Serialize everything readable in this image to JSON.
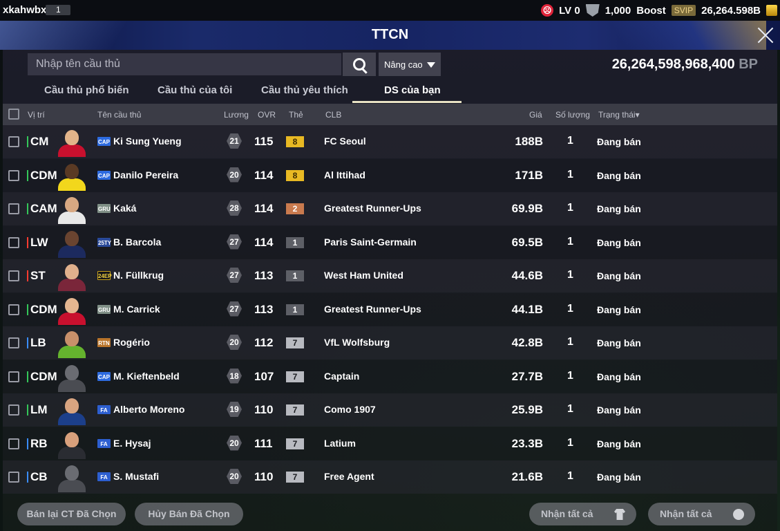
{
  "topbar": {
    "username": "xkahwbxf",
    "user_badge": "1",
    "level": "LV 0",
    "shield_count": "1,000",
    "boost_label": "Boost",
    "svip_label": "SVIP",
    "bp_short": "26,264.598B"
  },
  "header": {
    "title": "TTCN"
  },
  "search": {
    "placeholder": "Nhập tên cầu thủ",
    "advanced_label": "Nâng cao"
  },
  "balance": {
    "value": "26,264,598,968,400",
    "unit": "BP"
  },
  "tabs": [
    {
      "label": "Cầu thủ phổ biến"
    },
    {
      "label": "Cầu thủ của tôi"
    },
    {
      "label": "Cầu thủ yêu thích"
    },
    {
      "label": "DS của bạn"
    }
  ],
  "active_tab": "DS của bạn",
  "columns": {
    "position": "Vị trí",
    "name": "Tên cầu thủ",
    "salary": "Lương",
    "ovr": "OVR",
    "grade": "Thẻ",
    "club": "CLB",
    "price": "Giá",
    "quantity": "Số lượng",
    "status": "Trạng thái▾"
  },
  "position_colors": {
    "mid": "#34c759",
    "att": "#ff3b30",
    "def": "#3a8dff"
  },
  "players": [
    {
      "pos": "CM",
      "pos_group": "mid",
      "season": "CAP",
      "name": "Ki Sung Yueng",
      "salary": "21",
      "ovr": "115",
      "grade": "8",
      "club": "FC Seoul",
      "price": "188B",
      "qty": "1",
      "status": "Đang bán",
      "kit": "#c8102e",
      "skin": "#e2b48a"
    },
    {
      "pos": "CDM",
      "pos_group": "mid",
      "season": "CAP",
      "name": "Danilo Pereira",
      "salary": "20",
      "ovr": "114",
      "grade": "8",
      "club": "Al Ittihad",
      "price": "171B",
      "qty": "1",
      "status": "Đang bán",
      "kit": "#f2d71c",
      "skin": "#5a3a24"
    },
    {
      "pos": "CAM",
      "pos_group": "mid",
      "season": "GRU",
      "name": "Kaká",
      "salary": "28",
      "ovr": "114",
      "grade": "2",
      "club": "Greatest Runner-Ups",
      "price": "69.9B",
      "qty": "1",
      "status": "Đang bán",
      "kit": "#e8e8e8",
      "skin": "#d8a882"
    },
    {
      "pos": "LW",
      "pos_group": "att",
      "season": "25TY",
      "name": "B. Barcola",
      "salary": "27",
      "ovr": "114",
      "grade": "1",
      "club": "Paris Saint-Germain",
      "price": "69.5B",
      "qty": "1",
      "status": "Đang bán",
      "kit": "#1c2a5e",
      "skin": "#6a4430"
    },
    {
      "pos": "ST",
      "pos_group": "att",
      "season": "24EP",
      "name": "N. Füllkrug",
      "salary": "27",
      "ovr": "113",
      "grade": "1",
      "club": "West Ham United",
      "price": "44.6B",
      "qty": "1",
      "status": "Đang bán",
      "kit": "#7a263a",
      "skin": "#e0b08c"
    },
    {
      "pos": "CDM",
      "pos_group": "mid",
      "season": "GRU",
      "name": "M. Carrick",
      "salary": "27",
      "ovr": "113",
      "grade": "1",
      "club": "Greatest Runner-Ups",
      "price": "44.1B",
      "qty": "1",
      "status": "Đang bán",
      "kit": "#c8102e",
      "skin": "#e4b690"
    },
    {
      "pos": "LB",
      "pos_group": "def",
      "season": "RTN",
      "name": "Rogério",
      "salary": "20",
      "ovr": "112",
      "grade": "7",
      "club": "VfL Wolfsburg",
      "price": "42.8B",
      "qty": "1",
      "status": "Đang bán",
      "kit": "#65b32e",
      "skin": "#c8906a"
    },
    {
      "pos": "CDM",
      "pos_group": "mid",
      "season": "CAP",
      "name": "M. Kieftenbeld",
      "salary": "18",
      "ovr": "107",
      "grade": "7",
      "club": "Captain",
      "price": "27.7B",
      "qty": "1",
      "status": "Đang bán",
      "kit": "#4a4c52",
      "skin": "#6a6c72"
    },
    {
      "pos": "LM",
      "pos_group": "mid",
      "season": "FA",
      "name": "Alberto Moreno",
      "salary": "19",
      "ovr": "110",
      "grade": "7",
      "club": "Como 1907",
      "price": "25.9B",
      "qty": "1",
      "status": "Đang bán",
      "kit": "#1c3f8a",
      "skin": "#d8a480"
    },
    {
      "pos": "RB",
      "pos_group": "def",
      "season": "FA",
      "name": "E. Hysaj",
      "salary": "20",
      "ovr": "111",
      "grade": "7",
      "club": "Latium",
      "price": "23.3B",
      "qty": "1",
      "status": "Đang bán",
      "kit": "#2a2c32",
      "skin": "#d8a07c"
    },
    {
      "pos": "CB",
      "pos_group": "def",
      "season": "FA",
      "name": "S. Mustafi",
      "salary": "20",
      "ovr": "110",
      "grade": "7",
      "club": "Free Agent",
      "price": "21.6B",
      "qty": "1",
      "status": "Đang bán",
      "kit": "#4a4c52",
      "skin": "#6a6c72"
    }
  ],
  "grade_colors": {
    "8": "#e8b923",
    "2": "#c97a4e",
    "1": "#5d5f66",
    "7": "#b8bac0"
  },
  "season_colors": {
    "CAP": "#2d6be0",
    "GRU": "#7f8f86",
    "25TY": "#2a4a9a",
    "24EP": "#c9a21a",
    "RTN": "#b9742a",
    "FA": "#2d5fd0"
  },
  "buttons": {
    "resell": "Bán lại CT Đã Chọn",
    "cancel": "Hủy Bán Đã Chọn",
    "claim_players": "Nhận tất cả",
    "claim_bp": "Nhận tất cả"
  }
}
